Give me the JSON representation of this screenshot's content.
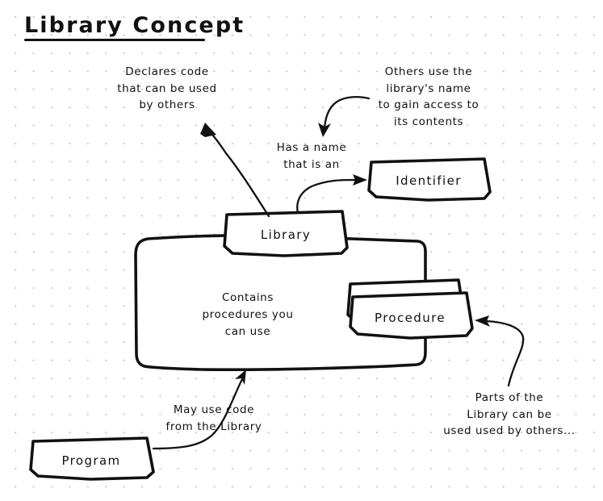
{
  "diagram": {
    "title": "Library Concept",
    "kind": "hand-drawn concept sketch",
    "boxes": {
      "library_label": "Library",
      "identifier": "Identifier",
      "procedure": "Procedure",
      "program": "Program",
      "container_text_line1": "Contains",
      "container_text_line2": "procedures you",
      "container_text_line3": "can use"
    },
    "annotations": {
      "declares": "Declares code\nthat can be used\nby others",
      "others_use": "Others use the\nlibrary's name\nto gain access to\nits contents",
      "has_a_name": "Has a name\nthat is an",
      "may_use_code": "May use code\nfrom the Library",
      "parts_of_library": "Parts of the\nLibrary can be\nused used by others..."
    },
    "colors": {
      "ink": "#111111",
      "paper": "#ffffff",
      "grid_dot": "#c9c9cf"
    }
  }
}
